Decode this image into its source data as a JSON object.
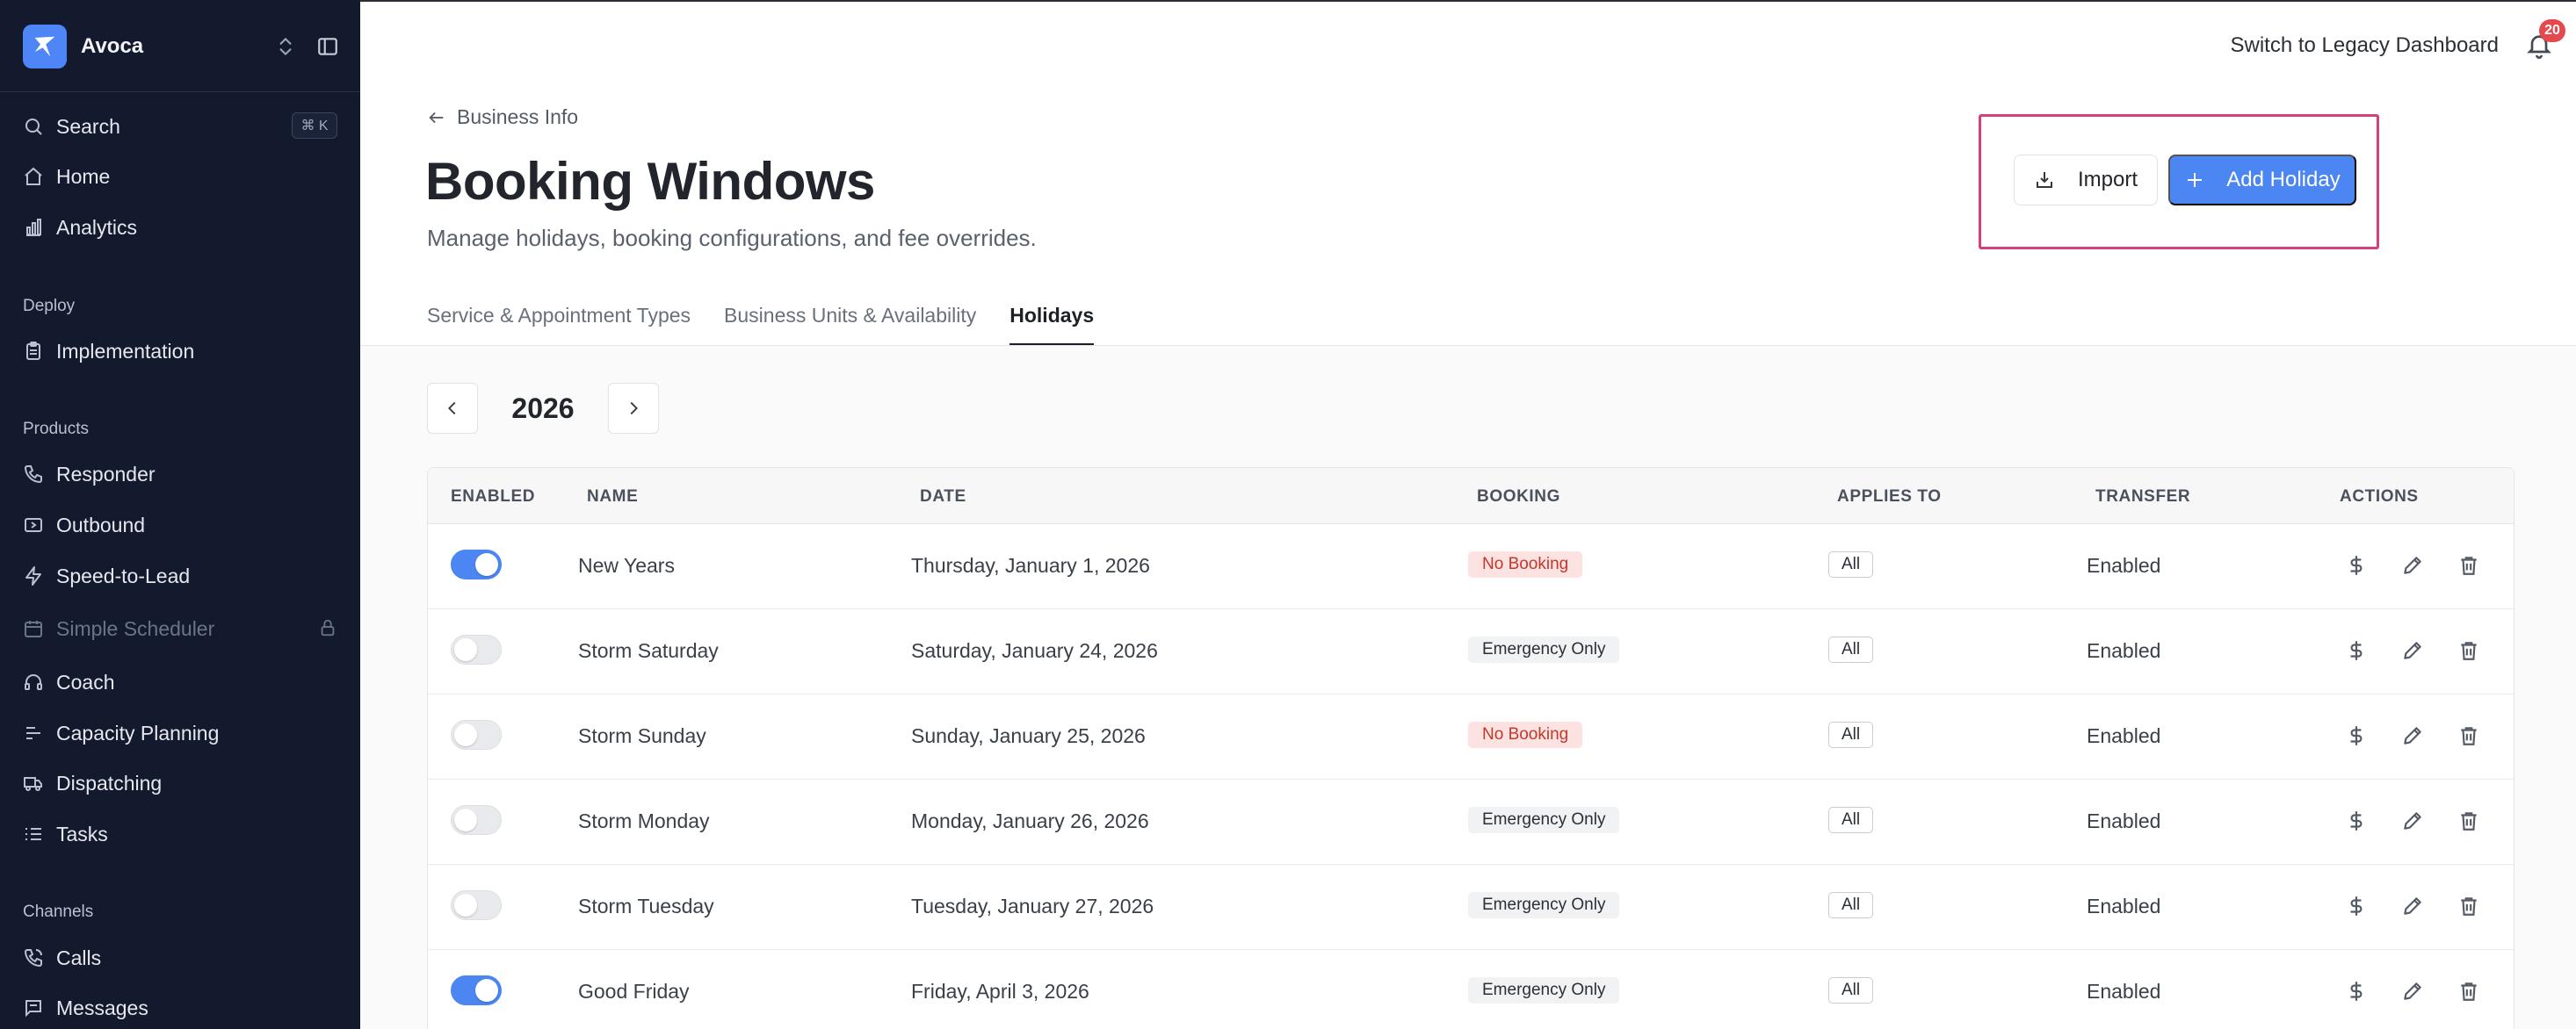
{
  "sidebar": {
    "brand_name": "Avoca",
    "search_label": "Search",
    "search_shortcut": "⌘ K",
    "items": [
      {
        "label": "Home",
        "icon": "home-icon"
      },
      {
        "label": "Analytics",
        "icon": "bar-chart-icon"
      }
    ],
    "sections": [
      {
        "label": "Deploy",
        "items": [
          {
            "label": "Implementation",
            "icon": "clipboard-icon"
          }
        ]
      },
      {
        "label": "Products",
        "items": [
          {
            "label": "Responder",
            "icon": "phone-icon"
          },
          {
            "label": "Outbound",
            "icon": "outbound-icon"
          },
          {
            "label": "Speed-to-Lead",
            "icon": "lightning-icon"
          },
          {
            "label": "Simple Scheduler",
            "icon": "calendar-icon",
            "disabled": true
          },
          {
            "label": "Coach",
            "icon": "headset-icon"
          },
          {
            "label": "Capacity Planning",
            "icon": "capacity-icon"
          },
          {
            "label": "Dispatching",
            "icon": "truck-icon"
          },
          {
            "label": "Tasks",
            "icon": "list-icon"
          }
        ]
      },
      {
        "label": "Channels",
        "items": [
          {
            "label": "Calls",
            "icon": "phone-call-icon"
          },
          {
            "label": "Messages",
            "icon": "message-icon"
          }
        ]
      }
    ]
  },
  "header": {
    "legacy_link": "Switch to Legacy Dashboard",
    "notification_count": "20"
  },
  "page": {
    "breadcrumb": "Business Info",
    "title": "Booking Windows",
    "subtitle": "Manage holidays, booking configurations, and fee overrides.",
    "import_label": "Import",
    "add_label": "Add Holiday",
    "tabs": [
      {
        "label": "Service & Appointment Types",
        "active": false
      },
      {
        "label": "Business Units & Availability",
        "active": false
      },
      {
        "label": "Holidays",
        "active": true
      }
    ],
    "year": "2026"
  },
  "table": {
    "columns": [
      "ENABLED",
      "NAME",
      "DATE",
      "BOOKING",
      "APPLIES TO",
      "TRANSFER",
      "ACTIONS"
    ],
    "rows": [
      {
        "enabled": true,
        "name": "New Years",
        "date": "Thursday, January 1, 2026",
        "booking": "No Booking",
        "booking_type": "no",
        "applies": "All",
        "transfer": "Enabled"
      },
      {
        "enabled": false,
        "name": "Storm Saturday",
        "date": "Saturday, January 24, 2026",
        "booking": "Emergency Only",
        "booking_type": "em",
        "applies": "All",
        "transfer": "Enabled"
      },
      {
        "enabled": false,
        "name": "Storm Sunday",
        "date": "Sunday, January 25, 2026",
        "booking": "No Booking",
        "booking_type": "no",
        "applies": "All",
        "transfer": "Enabled"
      },
      {
        "enabled": false,
        "name": "Storm Monday",
        "date": "Monday, January 26, 2026",
        "booking": "Emergency Only",
        "booking_type": "em",
        "applies": "All",
        "transfer": "Enabled"
      },
      {
        "enabled": false,
        "name": "Storm Tuesday",
        "date": "Tuesday, January 27, 2026",
        "booking": "Emergency Only",
        "booking_type": "em",
        "applies": "All",
        "transfer": "Enabled"
      },
      {
        "enabled": true,
        "name": "Good Friday",
        "date": "Friday, April 3, 2026",
        "booking": "Emergency Only",
        "booking_type": "em",
        "applies": "All",
        "transfer": "Enabled"
      }
    ]
  },
  "colors": {
    "sidebar_bg": "#141a2e",
    "accent": "#4b86f3",
    "highlight": "#d63f7b",
    "no_booking_bg": "#fde2e2",
    "no_booking_text": "#c0392b"
  }
}
